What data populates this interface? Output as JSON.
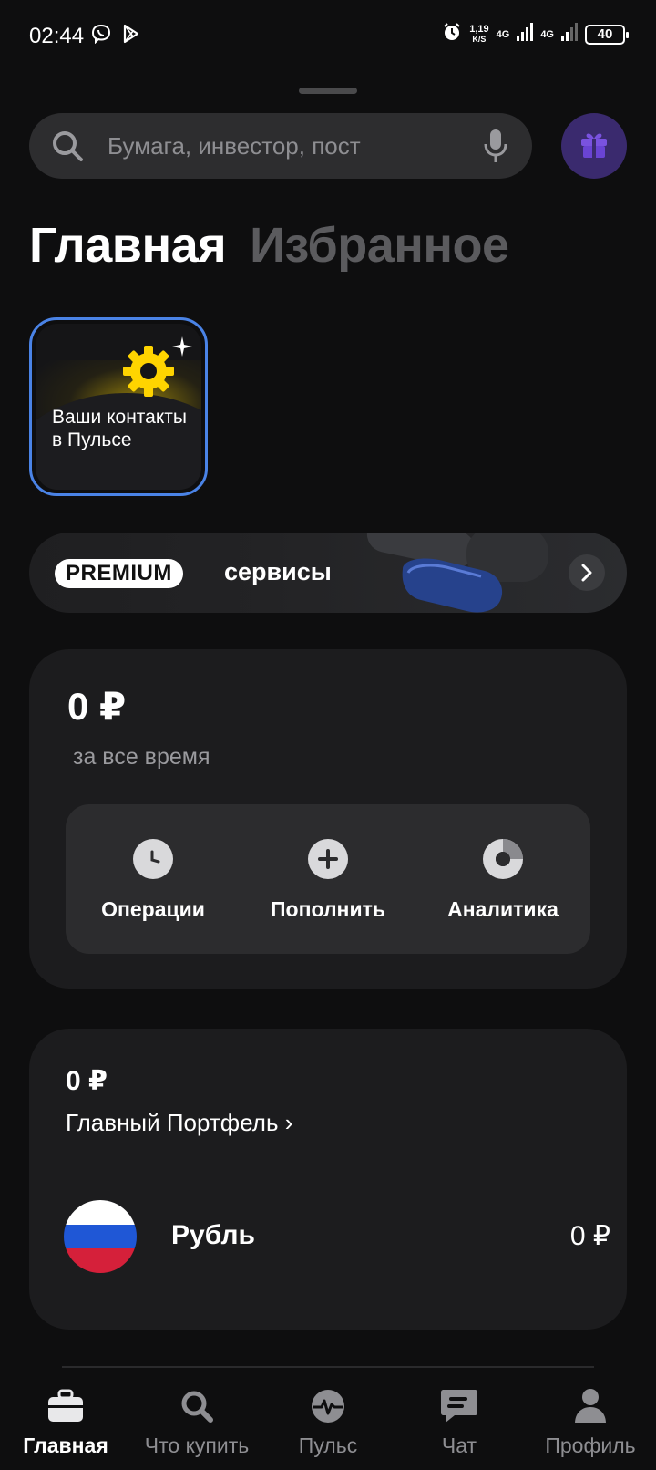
{
  "status_bar": {
    "time": "02:44",
    "speed_value": "1,19",
    "speed_unit": "K/S",
    "net1": "4G",
    "net2": "4G",
    "battery": "40"
  },
  "search": {
    "placeholder": "Бумага, инвестор, пост"
  },
  "tabs": [
    {
      "label": "Главная",
      "active": true
    },
    {
      "label": "Избранное",
      "active": false
    }
  ],
  "story": {
    "text": "Ваши контакты в Пульсе"
  },
  "premium": {
    "badge": "PREMIUM",
    "label": "сервисы"
  },
  "balance": {
    "amount": "0 ₽",
    "caption": "за все время",
    "actions": [
      {
        "label": "Операции",
        "icon": "clock-icon"
      },
      {
        "label": "Пополнить",
        "icon": "plus-icon"
      },
      {
        "label": "Аналитика",
        "icon": "donut-chart-icon"
      }
    ]
  },
  "portfolio": {
    "amount": "0 ₽",
    "name": "Главный Портфель ›",
    "currency": {
      "name": "Рубль",
      "amount": "0 ₽",
      "flag_colors": [
        "#ffffff",
        "#1f57d6",
        "#d5203a"
      ]
    }
  },
  "bottom_nav": [
    {
      "label": "Главная",
      "icon": "briefcase-icon",
      "active": true
    },
    {
      "label": "Что купить",
      "icon": "search-icon",
      "active": false
    },
    {
      "label": "Пульс",
      "icon": "pulse-icon",
      "active": false
    },
    {
      "label": "Чат",
      "icon": "chat-icon",
      "active": false
    },
    {
      "label": "Профиль",
      "icon": "profile-icon",
      "active": false
    }
  ],
  "colors": {
    "background": "#0e0e0f",
    "card": "#1c1c1e",
    "accent_blue": "#4a83e6",
    "gift_bg": "#3a2a6e",
    "gear_yellow": "#ffd400"
  }
}
